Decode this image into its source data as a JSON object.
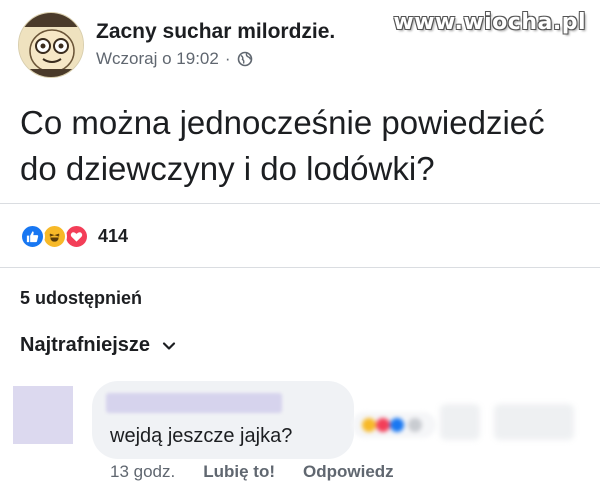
{
  "watermark": "www.wiocha.pl",
  "post": {
    "page_name": "Zacny suchar milordzie.",
    "timestamp": "Wczoraj o 19:02",
    "separator": "·",
    "audience_icon": "globe-icon",
    "text_line1": "Co można jednocześnie powiedzieć",
    "text_line2": "do dziewczyny i do lodówki?"
  },
  "reactions": {
    "icons": [
      "like-icon",
      "haha-icon",
      "love-icon"
    ],
    "count": "414"
  },
  "shares_label": "5 udostępnień",
  "sort_label": "Najtrafniejsze",
  "comment": {
    "text": "wejdą jeszcze jajka?",
    "time": "13 godz.",
    "like_label": "Lubię to!",
    "reply_label": "Odpowiedz"
  },
  "colors": {
    "like": "#1877f2",
    "haha": "#f7b928",
    "love": "#f33e58",
    "secondary_text": "#606770",
    "bubble": "#f0f2f5"
  }
}
